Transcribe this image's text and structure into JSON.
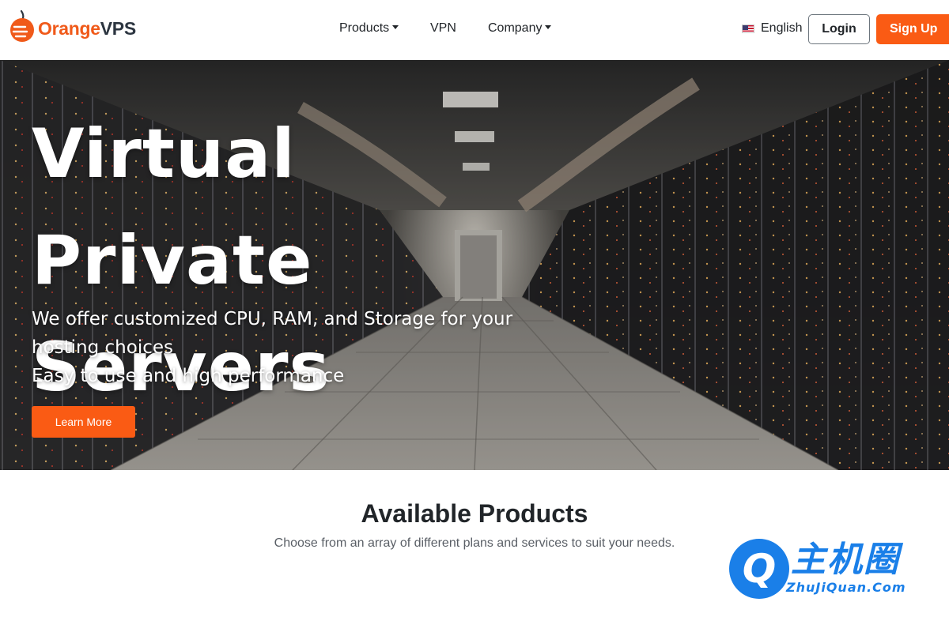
{
  "brand": {
    "name_orange": "Orange",
    "name_dark": "VPS",
    "accent": "#fa5b14",
    "dark": "#2c3540"
  },
  "nav": {
    "items": [
      {
        "label": "Products",
        "dropdown": true
      },
      {
        "label": "VPN",
        "dropdown": false
      },
      {
        "label": "Company",
        "dropdown": true
      }
    ],
    "language": {
      "label": "English",
      "icon": "us-flag-icon"
    },
    "login_label": "Login",
    "signup_label": "Sign Up"
  },
  "hero": {
    "title_line1": "Virtual Private",
    "title_line2": "Servers",
    "subtitle_line1": "We offer customized CPU, RAM, and Storage for your hosting choices",
    "subtitle_line2": "Easy to use and high performance",
    "cta_label": "Learn More"
  },
  "products": {
    "title": "Available Products",
    "subtitle": "Choose from an array of different plans and services to suit your needs."
  },
  "watermark": {
    "letter": "Q",
    "text_cn": "主机圈",
    "text_en": "ZhuJiQuan.Com",
    "color": "#1a7fe8"
  }
}
